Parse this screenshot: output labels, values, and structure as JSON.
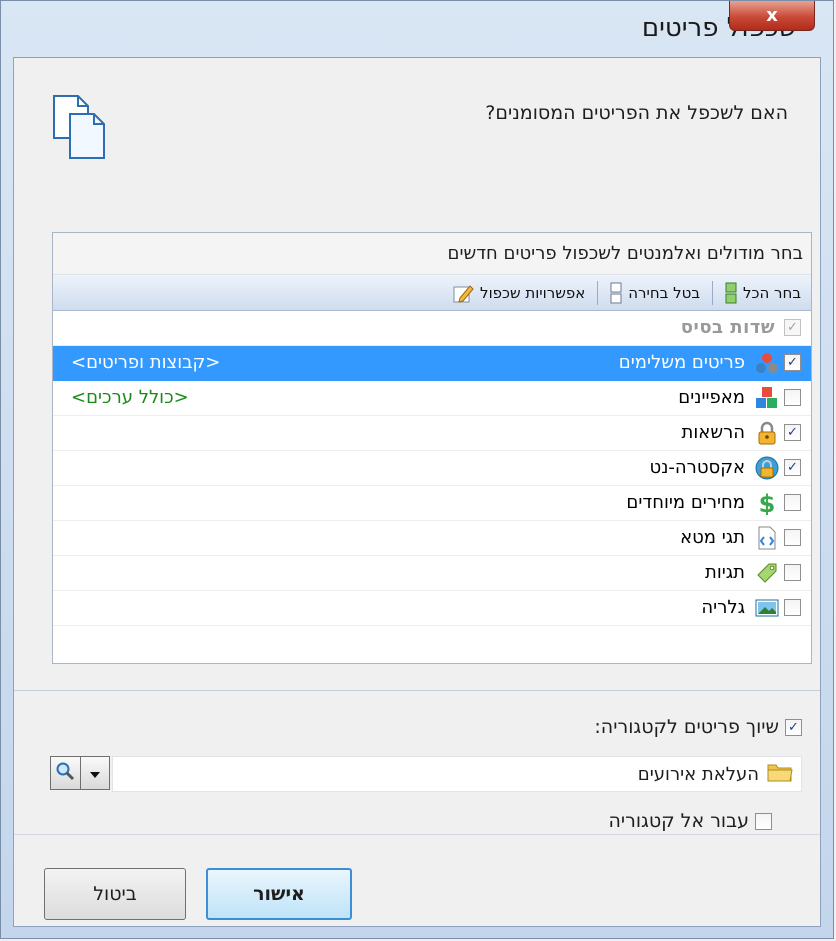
{
  "window": {
    "title": "שכפול פריטים",
    "close_glyph": "x"
  },
  "question": "האם לשכפל את הפריטים המסומנים?",
  "panel": {
    "header": "בחר מודולים ואלמנטים לשכפול פריטים חדשים",
    "toolbar": {
      "select_all": "בחר הכל",
      "clear_selection": "בטל בחירה",
      "options": "אפשרויות שכפול"
    },
    "rows": [
      {
        "label": "שדות בסיס",
        "checked": true,
        "disabled": true,
        "icon": "none",
        "note": ""
      },
      {
        "label": "פריטים משלימים",
        "checked": true,
        "selected": true,
        "icon": "related-items-icon",
        "note": "<קבוצות ופריטים>"
      },
      {
        "label": "מאפיינים",
        "checked": false,
        "icon": "properties-icon",
        "note": "<כולל ערכים>"
      },
      {
        "label": "הרשאות",
        "checked": true,
        "icon": "lock-icon",
        "note": ""
      },
      {
        "label": "אקסטרה-נט",
        "checked": true,
        "icon": "extranet-icon",
        "note": ""
      },
      {
        "label": "מחירים מיוחדים",
        "checked": false,
        "icon": "dollar-icon",
        "note": ""
      },
      {
        "label": "תגי מטא",
        "checked": false,
        "icon": "meta-tags-icon",
        "note": ""
      },
      {
        "label": "תגיות",
        "checked": false,
        "icon": "tag-icon",
        "note": ""
      },
      {
        "label": "גלריה",
        "checked": false,
        "icon": "gallery-icon",
        "note": ""
      }
    ]
  },
  "assign_category": {
    "label": "שיוך פריטים לקטגוריה:",
    "checked": true
  },
  "category_value": "העלאת אירועים",
  "goto_category": {
    "label": "עבור אל קטגוריה",
    "checked": false
  },
  "buttons": {
    "ok": "אישור",
    "cancel": "ביטול"
  },
  "check_glyph": "✓"
}
